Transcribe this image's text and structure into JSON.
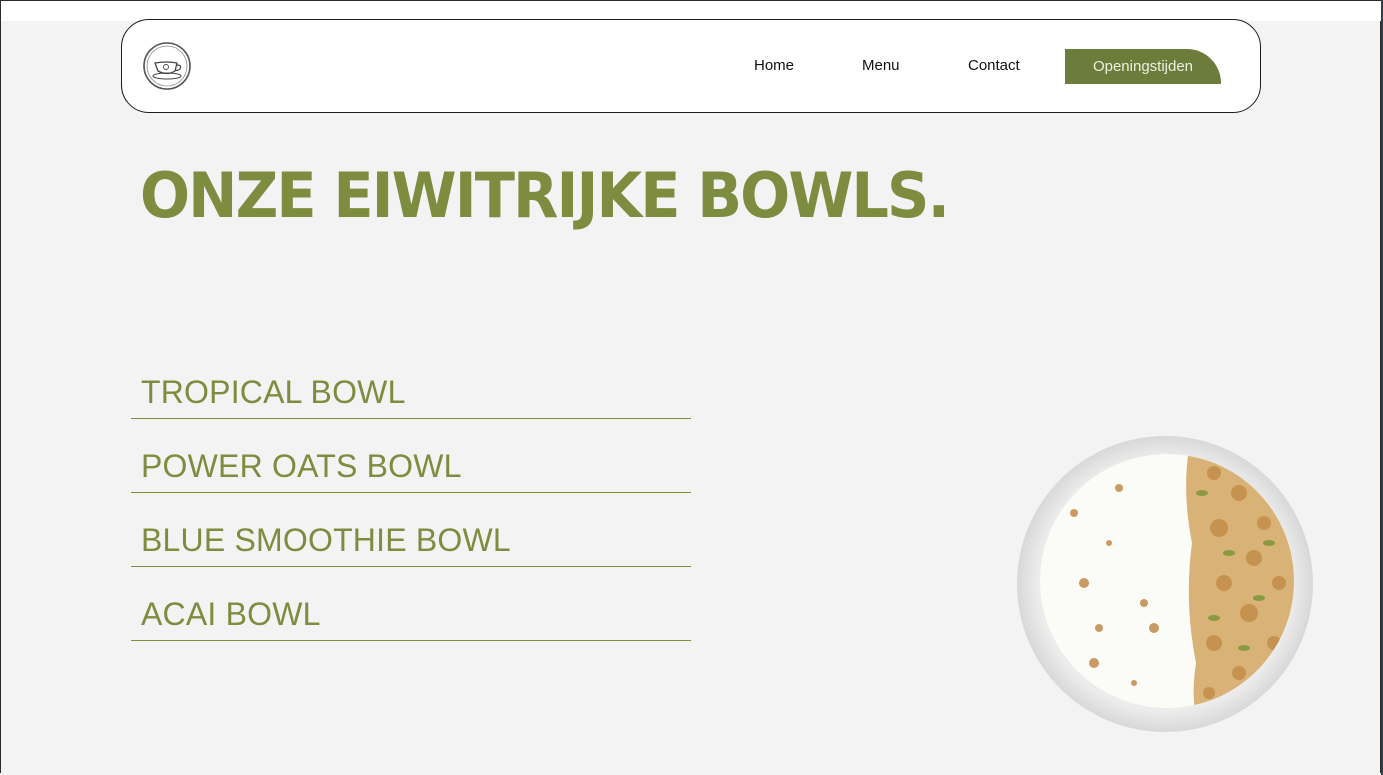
{
  "nav": {
    "logo_icon": "coffee-cup-logo-icon",
    "links": [
      "Home",
      "Menu",
      "Contact"
    ],
    "cta_label": "Openingstijden"
  },
  "hero": {
    "title": "Onze eiwitrijke bowls."
  },
  "bowls": [
    "TROPICAL BOWL",
    "POWER OATS BOWL",
    "BLUE SMOOTHIE BOWL",
    "ACAI BOWL"
  ],
  "colors": {
    "accent": "#7d8c3f",
    "button": "#6c7c3b",
    "background": "#f3f3f3"
  },
  "image": {
    "icon": "granola-milk-bowl-photo"
  }
}
